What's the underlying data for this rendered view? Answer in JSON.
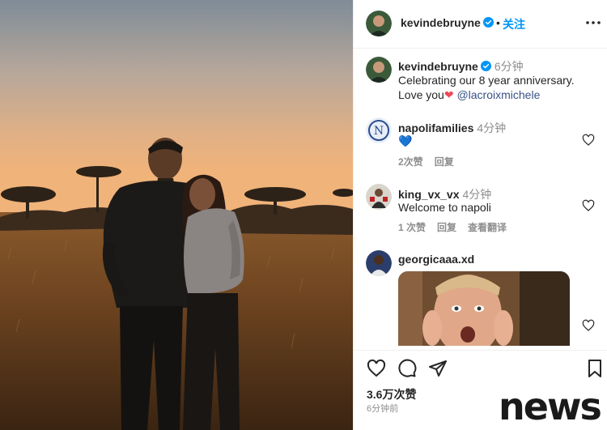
{
  "post": {
    "username": "kevindebruyne",
    "verified": true,
    "separator": "•",
    "follow_label": "关注",
    "caption": {
      "username": "kevindebruyne",
      "time": "6分钟",
      "line1": "Celebrating our 8 year anniversary.",
      "line2_prefix": "Love you",
      "heart": "❤",
      "mention": "@lacroixmichele"
    }
  },
  "comments": [
    {
      "username": "napolifamilies",
      "time": "4分钟",
      "text": "💙",
      "likes_label": "2次赞",
      "reply_label": "回复"
    },
    {
      "username": "king_vx_vx",
      "time": "4分钟",
      "text": "Welcome to napoli",
      "likes_label": "1 次赞",
      "reply_label": "回复",
      "translate_label": "查看翻译"
    },
    {
      "username": "georgicaaa.xd"
    }
  ],
  "footer": {
    "likes": "3.6万次赞",
    "time_ago": "6分钟前"
  },
  "watermark": "news",
  "icons": {
    "more": "more-icon",
    "heart": "heart-icon",
    "comment": "comment-icon",
    "share": "share-icon",
    "bookmark": "bookmark-icon"
  },
  "colors": {
    "accent": "#0095f6",
    "verified": "#0095f6",
    "mention": "#385185",
    "muted": "#8e8e8e",
    "heart": "#ed4956"
  }
}
